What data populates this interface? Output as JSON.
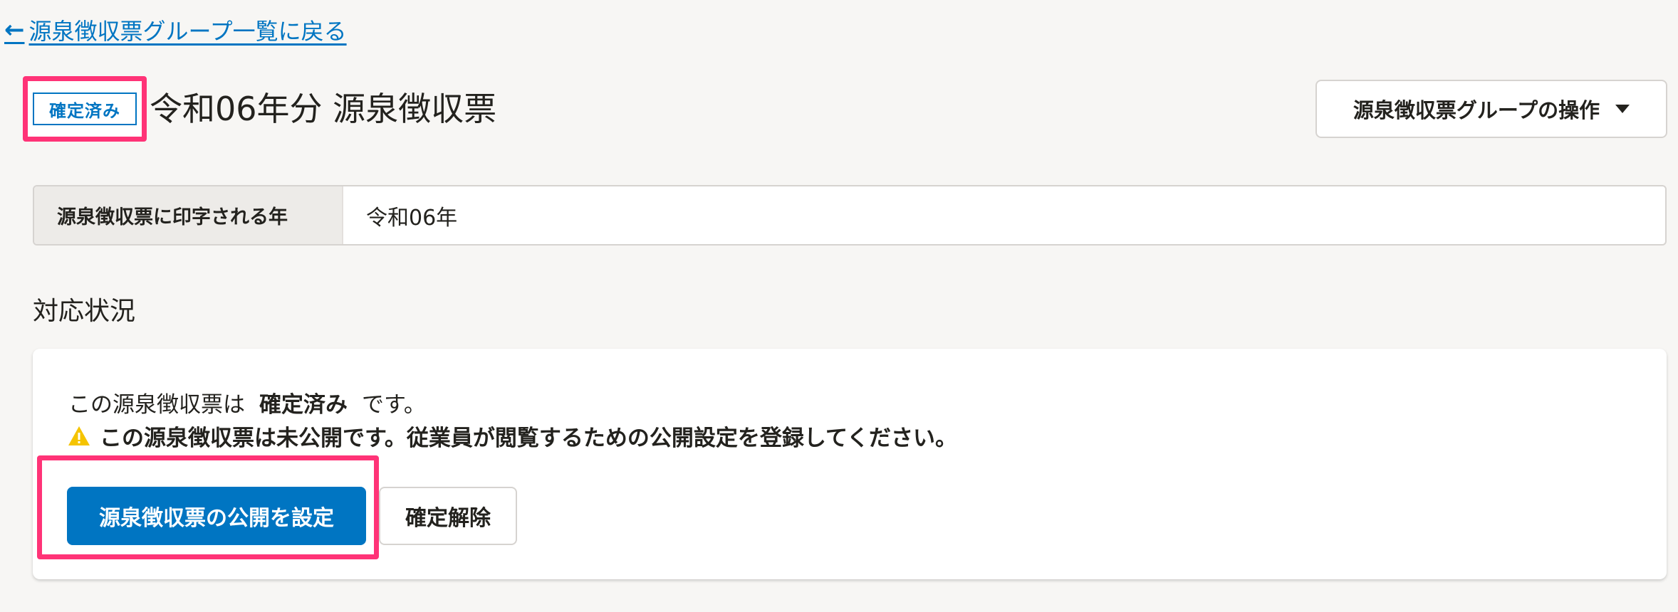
{
  "back_link": {
    "label": "源泉徴収票グループ一覧に戻る",
    "icon": "arrow-left-icon"
  },
  "header": {
    "status_badge": "確定済み",
    "title": "令和06年分 源泉徴収票",
    "operations_button": "源泉徴収票グループの操作",
    "operations_icon": "caret-down-icon"
  },
  "definition": {
    "label": "源泉徴収票に印字される年",
    "value": "令和06年"
  },
  "section": {
    "title": "対応状況"
  },
  "status_panel": {
    "status_prefix": "この源泉徴収票は",
    "status_value": "確定済み",
    "status_suffix": "です。",
    "warning_icon": "warning-icon",
    "warning_text": "この源泉徴収票は未公開です。従業員が閲覧するための公開設定を登録してください。",
    "primary_button": "源泉徴収票の公開を設定",
    "secondary_button": "確定解除"
  },
  "colors": {
    "accent": "#0075c2",
    "highlight": "#ff3377",
    "warning": "#f5c400",
    "background": "#f7f6f4"
  }
}
